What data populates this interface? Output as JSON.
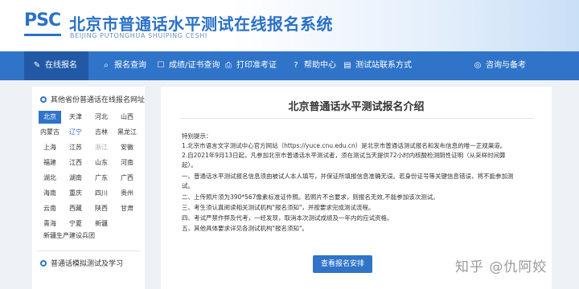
{
  "header": {
    "logo": "PSC",
    "title": "北京市普通话水平测试在线报名系统",
    "subtitle": "BEIJING PUTONGHUA SHUIPING CESHI"
  },
  "nav": {
    "items": [
      {
        "label": "在线报名",
        "icon": "edit-icon"
      },
      {
        "label": "报名查询",
        "icon": "search-icon"
      },
      {
        "label": "成绩/证书查询",
        "icon": "certificate-icon"
      },
      {
        "label": "打印准考证",
        "icon": "print-icon"
      },
      {
        "label": "帮助中心",
        "icon": "help-icon"
      },
      {
        "label": "测试站联系方式",
        "icon": "contact-icon"
      },
      {
        "label": "咨询与备考",
        "icon": "globe-icon"
      }
    ]
  },
  "sidebar": {
    "section1_title": "其他省份普通话在线报名网址",
    "provinces": [
      "北京",
      "天津",
      "河北",
      "山西",
      "内蒙古",
      "辽宁",
      "吉林",
      "黑龙江",
      "上海",
      "江苏",
      "浙江",
      "安徽",
      "福建",
      "江西",
      "山东",
      "河南",
      "湖北",
      "湖南",
      "广东",
      "广西",
      "海南",
      "重庆",
      "四川",
      "贵州",
      "云南",
      "西藏",
      "陕西",
      "甘肃",
      "青海",
      "宁夏",
      "新疆"
    ],
    "extra": "新疆生产建设兵团",
    "section2_title": "普通话模拟测试及学习"
  },
  "content": {
    "title": "北京普通话水平测试报名介绍",
    "lines": [
      "特别提示：",
      "1.北京市语言文字测试中心官方网站（https://yuce.cnu.edu.cn）是北京市普通话测试报名和发布信息的唯一正规渠道。",
      "2.自2021年9月13日起，凡参加北京市普通话水平测试者，须在测试当天提供72小时内核酸检测阴性证明（从采样时间算",
      "起）。",
      "一、普通话水平测试报名信息须由被试人本人填写，并保证所填报信息准确无误。若身份证号等关键信息错误，将不能参加测",
      "试。",
      "二、上传照片须为390*567像素标准证件照。若照片不合要求，则报名无效,不能参加该次测试。",
      "三、考生须认真阅读相关测试机构\"报名须知\"，并按要求完成测试流程。",
      "四、考试严禁作弊及代考，一经发现，取消本次测试成绩及一年内的应试资格。",
      "五、其他具体要求详见各测试机构\"报名须知\"。"
    ],
    "button": "查看报名安排"
  },
  "watermark": "知乎 @仇阿姣",
  "colors": {
    "primary": "#2f74c8",
    "nav_active": "#2259a6",
    "background": "#eef2f7"
  }
}
